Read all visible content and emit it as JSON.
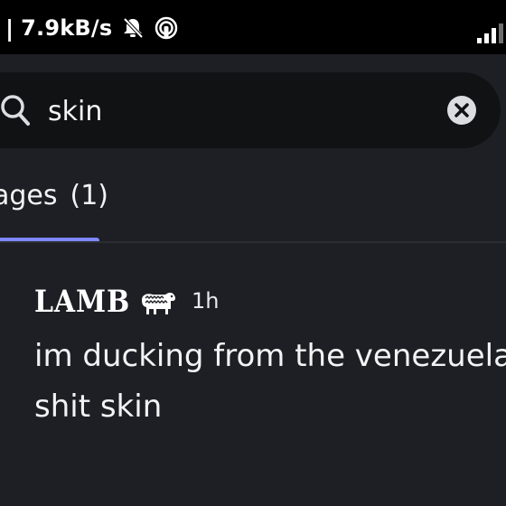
{
  "status_bar": {
    "separator": "|",
    "network_speed": "7.9kB/s",
    "icons": [
      "notifications-muted-icon",
      "hotspot-icon",
      "signal-strength-icon"
    ]
  },
  "search": {
    "query": "skin",
    "icon": "search-icon",
    "clear_icon": "close-icon"
  },
  "tabs": {
    "messages_label": "ages",
    "messages_count": "(1)",
    "active_color": "#7f86ff"
  },
  "result": {
    "author": "LAMB",
    "author_emoji": "lamb-icon",
    "time": "1h",
    "lines": [
      "im ducking from the venezuela",
      "shit skin"
    ]
  },
  "colors": {
    "background": "#1e1f24",
    "search_field": "#111214",
    "status_bar": "#000000"
  }
}
